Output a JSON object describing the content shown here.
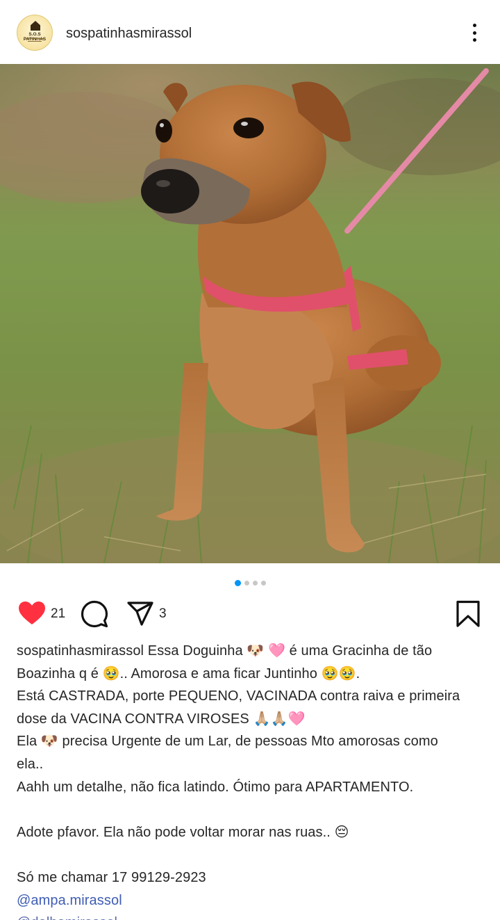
{
  "post": {
    "username": "sospatinhasmirassol",
    "avatar_text": "S.O.S PATINHAS",
    "more_icon": "more-vertical-icon",
    "image_alt": "dog-photo",
    "carousel": {
      "total": 4,
      "active": 1
    },
    "likes": "21",
    "shares": "3",
    "like_color": "#ff3040",
    "link_color": "#3f5db3"
  },
  "caption": {
    "line1_user": "sospatinhasmirassol",
    "line1_text": " Essa Doguinha 🐶 🩷 é uma Gracinha de tão",
    "line2": "Boazinha q é 🥹.. Amorosa e ama ficar Juntinho 🥹🥹.",
    "line3": "Está CASTRADA, porte PEQUENO, VACINADA contra raiva e primeira",
    "line4": "dose da VACINA CONTRA VIROSES 🙏🏼🙏🏼🩷",
    "line5": "Ela 🐶 precisa Urgente de um Lar, de pessoas Mto amorosas como",
    "line6": "ela..",
    "line7": "Aahh um detalhe, não fica latindo. Ótimo para APARTAMENTO.",
    "line8": "Adote pfavor. Ela não pode voltar morar nas ruas.. 😔",
    "line9": "Só me chamar 17 99129-2923",
    "mention": "@ampa.mirassol",
    "cut_line": "@dalbamirassol"
  }
}
